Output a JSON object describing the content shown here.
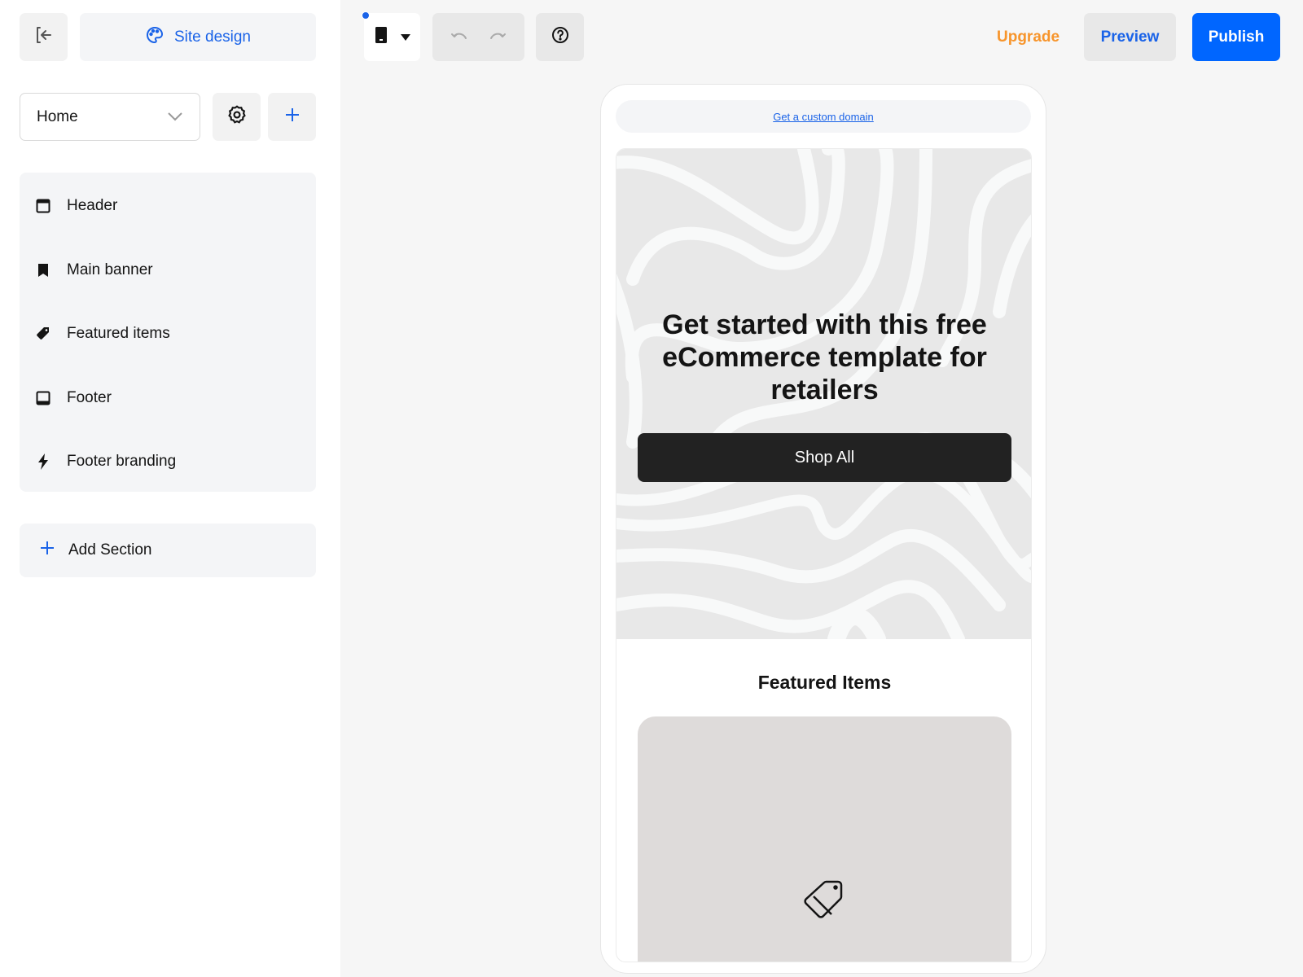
{
  "sidebar": {
    "exit_icon": "exit-arrow-icon",
    "site_design_label": "Site design",
    "site_design_icon": "palette-icon",
    "page_select": {
      "value": "Home"
    },
    "settings_icon": "gear-icon",
    "add_page_icon": "plus-icon",
    "sections": [
      {
        "label": "Header",
        "icon": "header-icon"
      },
      {
        "label": "Main banner",
        "icon": "bookmark-icon"
      },
      {
        "label": "Featured items",
        "icon": "tag-icon"
      },
      {
        "label": "Footer",
        "icon": "footer-icon"
      },
      {
        "label": "Footer branding",
        "icon": "bolt-icon"
      }
    ],
    "add_section_label": "Add Section"
  },
  "toolbar": {
    "device_icon": "mobile-device-icon",
    "undo_icon": "undo-icon",
    "redo_icon": "redo-icon",
    "help_icon": "help-icon",
    "upgrade_label": "Upgrade",
    "preview_label": "Preview",
    "publish_label": "Publish"
  },
  "preview": {
    "domain_link": "Get a custom domain",
    "hero_title": "Get started with this free eCommerce template for retailers",
    "hero_button": "Shop All",
    "featured_title": "Featured Items",
    "product_placeholder_icon": "price-tag-icon"
  },
  "colors": {
    "accent_blue": "#1a63e8",
    "publish_blue": "#0066ff",
    "upgrade_orange": "#f7952c",
    "button_dark": "#222222"
  }
}
